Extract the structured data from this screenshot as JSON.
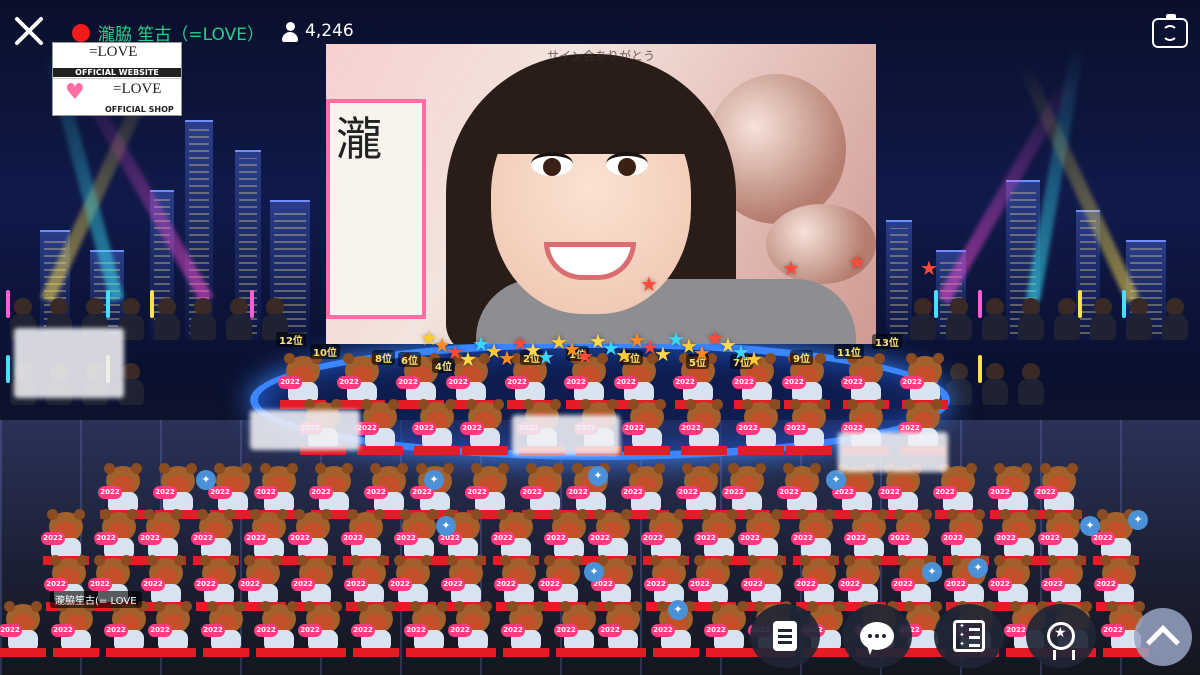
{
  "header": {
    "streamer_name": "瀧脇 笙古（=LOVE）",
    "viewer_count": "4,246"
  },
  "logos": {
    "website_mark": "=LOVE",
    "website_label": "OFFICIAL WEBSITE",
    "shop_mark": "=LOVE",
    "shop_label": "OFFICIAL SHOP"
  },
  "video": {
    "caption": "サイン会ありがとう",
    "banner_text": "瀧"
  },
  "ranks": [
    "12位",
    "10位",
    "8位",
    "6位",
    "4位",
    "2位",
    "1位",
    "3位",
    "5位",
    "7位",
    "9位",
    "11位",
    "13位"
  ],
  "avatar": {
    "badge_year": "2022",
    "ribbon_text": "瀧脇 笙古",
    "name_chip": "瀧脇笙古(= LOVE"
  },
  "icons": {
    "close": "close-icon",
    "live": "live-indicator-icon",
    "viewers": "person-icon",
    "camera_switch": "camera-switch-icon",
    "document": "document-icon",
    "comment": "chat-bubble-icon",
    "ranking": "list-star-icon",
    "award": "award-icon",
    "collapse": "chevron-up-icon"
  },
  "colors": {
    "live_red": "#f21b1b",
    "name_green": "#25d08a",
    "control_bg": "#202636"
  }
}
